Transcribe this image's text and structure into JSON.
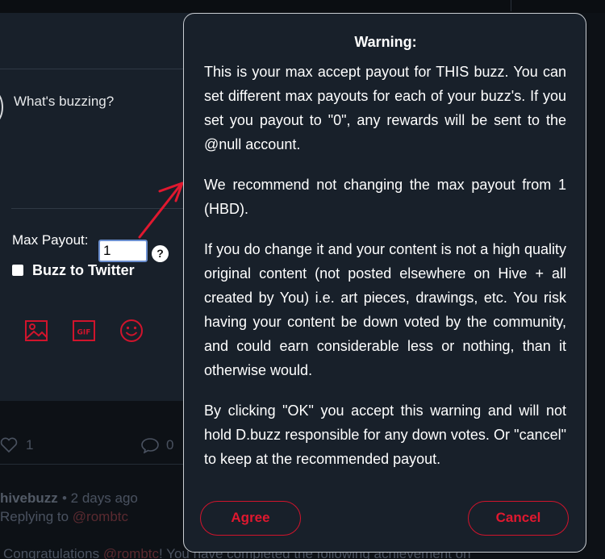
{
  "composer": {
    "placeholder": "What's buzzing?",
    "max_payout_label": "Max Payout:",
    "max_payout_value": "1",
    "help_icon": "?",
    "buzz_to_twitter_label": "Buzz to Twitter",
    "buzz_to_twitter_checked": false,
    "tools": [
      "image-icon",
      "gif-icon",
      "emoji-icon"
    ],
    "gif_text": "GIF"
  },
  "feed": {
    "like_count": "1",
    "comment_count": "0",
    "author": "hivebuzz",
    "time": "• 2 days ago",
    "replying_prefix": "Replying to ",
    "replying_user": "@rombtc",
    "body_prefix": "Congratulations ",
    "body_user": "@rombtc",
    "body_suffix": "! You have completed the following achievement on"
  },
  "modal": {
    "title": "Warning:",
    "paragraphs": [
      "This is your max accept payout for THIS buzz. You can set different max payouts for each of your buzz's. If you set you payout to \"0\", any rewards will be sent to the @null account.",
      "We recommend not changing the max payout from 1 (HBD).",
      "If you do change it and your content is not a high quality original content (not posted elsewhere on Hive + all created by You) i.e. art pieces, drawings, etc. You risk having your content be down voted by the community, and could earn considerable less or nothing, than it otherwise would.",
      "By clicking \"OK\" you accept this warning and will not hold D.buzz responsible for any down votes. Or \"cancel\" to keep at the recommended payout."
    ],
    "agree_label": "Agree",
    "cancel_label": "Cancel"
  },
  "colors": {
    "accent": "#e0182f",
    "panel": "#18202a",
    "background": "#0d1116"
  }
}
